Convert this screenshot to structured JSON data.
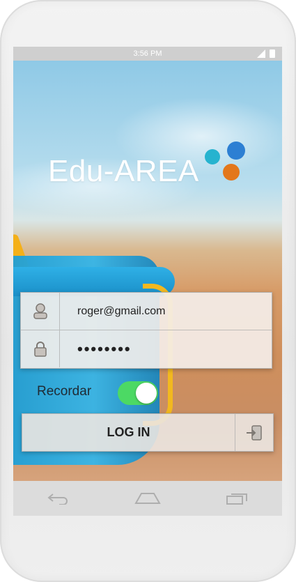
{
  "status_bar": {
    "time": "3:56 PM"
  },
  "app": {
    "logo_text": "Edu-AREA"
  },
  "login": {
    "email_value": "roger@gmail.com",
    "password_mask": "••••••••",
    "remember_label": "Recordar",
    "remember_on": true,
    "submit_label": "LOG IN"
  },
  "colors": {
    "toggle_on": "#4cd964",
    "dot_teal": "#26b3cf",
    "dot_blue": "#2d7fd3",
    "dot_orange": "#e3771b"
  },
  "icons": {
    "user": "user-icon",
    "lock": "lock-icon",
    "login": "login-icon",
    "back": "back-icon",
    "home": "home-icon",
    "recents": "recents-icon"
  }
}
